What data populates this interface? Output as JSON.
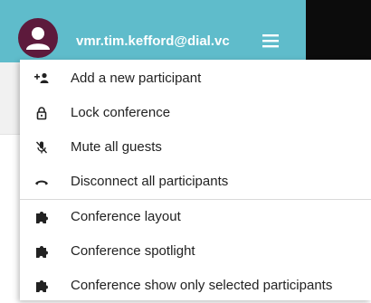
{
  "header": {
    "user_email": "vmr.tim.kefford@dial.vc",
    "avatar_icon": "person-icon",
    "menu_icon": "hamburger-menu-icon",
    "bg_color": "#5fbccb"
  },
  "menu": {
    "group1": [
      {
        "label": "Add a new participant",
        "icon": "add-person-icon"
      },
      {
        "label": "Lock conference",
        "icon": "lock-icon"
      },
      {
        "label": "Mute all guests",
        "icon": "mute-icon"
      },
      {
        "label": "Disconnect all participants",
        "icon": "hang-up-icon"
      }
    ],
    "group2": [
      {
        "label": "Conference layout",
        "icon": "puzzle-icon"
      },
      {
        "label": "Conference spotlight",
        "icon": "puzzle-icon"
      },
      {
        "label": "Conference show only selected participants",
        "icon": "puzzle-icon"
      }
    ]
  }
}
